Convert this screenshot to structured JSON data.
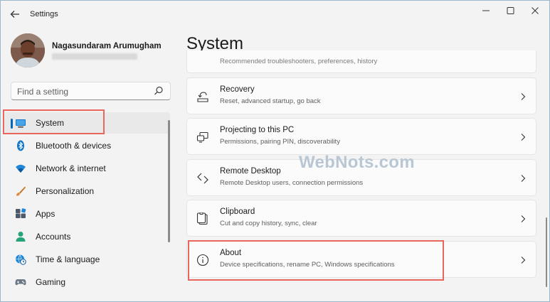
{
  "window": {
    "app_title": "Settings"
  },
  "profile": {
    "name": "Nagasundaram Arumugham"
  },
  "search": {
    "placeholder": "Find a setting"
  },
  "sidebar": {
    "items": [
      {
        "label": "System",
        "icon": "monitor-icon",
        "active": true
      },
      {
        "label": "Bluetooth & devices",
        "icon": "bluetooth-icon"
      },
      {
        "label": "Network & internet",
        "icon": "wifi-icon"
      },
      {
        "label": "Personalization",
        "icon": "brush-icon"
      },
      {
        "label": "Apps",
        "icon": "apps-icon"
      },
      {
        "label": "Accounts",
        "icon": "person-icon"
      },
      {
        "label": "Time & language",
        "icon": "globe-clock-icon"
      },
      {
        "label": "Gaming",
        "icon": "gamepad-icon"
      }
    ]
  },
  "main": {
    "title": "System",
    "partial_card": {
      "desc": "Recommended troubleshooters, preferences, history"
    },
    "cards": [
      {
        "title": "Recovery",
        "desc": "Reset, advanced startup, go back",
        "icon": "recovery-icon"
      },
      {
        "title": "Projecting to this PC",
        "desc": "Permissions, pairing PIN, discoverability",
        "icon": "projecting-icon"
      },
      {
        "title": "Remote Desktop",
        "desc": "Remote Desktop users, connection permissions",
        "icon": "remote-desktop-icon"
      },
      {
        "title": "Clipboard",
        "desc": "Cut and copy history, sync, clear",
        "icon": "clipboard-icon"
      },
      {
        "title": "About",
        "desc": "Device specifications, rename PC, Windows specifications",
        "icon": "info-icon"
      }
    ]
  },
  "watermark": "WebNots.com",
  "colors": {
    "accent": "#0067c0",
    "highlight": "#e8665b"
  }
}
